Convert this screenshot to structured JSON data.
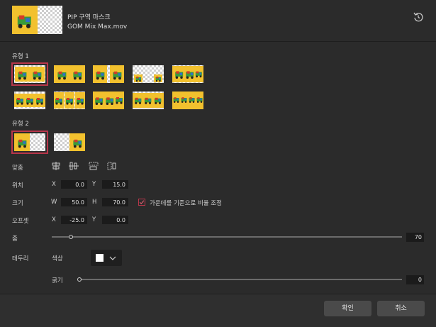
{
  "header": {
    "title": "PIP 구역 마스크",
    "filename": "GOM Mix Max.mov"
  },
  "type1": {
    "label": "유형 1"
  },
  "type2": {
    "label": "유형 2"
  },
  "align": {
    "label": "맞춤"
  },
  "position": {
    "label": "위치",
    "x_label": "X",
    "x": "0.0",
    "y_label": "Y",
    "y": "15.0"
  },
  "size": {
    "label": "크기",
    "w_label": "W",
    "w": "50.0",
    "h_label": "H",
    "h": "70.0",
    "ratio_checkbox": "가운데를 기준으로 비율 조정",
    "ratio_checked": true
  },
  "offset": {
    "label": "오프셋",
    "x_label": "X",
    "x": "-25.0",
    "y_label": "Y",
    "y": "0.0"
  },
  "zoom": {
    "label": "줌",
    "value": "70",
    "level": 0.055
  },
  "border": {
    "label": "테두리",
    "color_label": "색상",
    "color": "#ffffff",
    "thickness_label": "굵기",
    "thickness": "0",
    "thickness_level": 0
  },
  "footer": {
    "ok": "확인",
    "cancel": "취소"
  },
  "colors": {
    "accent": "#b8364a",
    "background": "#2b2b2b",
    "field": "#1b1b1b",
    "button": "#4a4a4a"
  }
}
